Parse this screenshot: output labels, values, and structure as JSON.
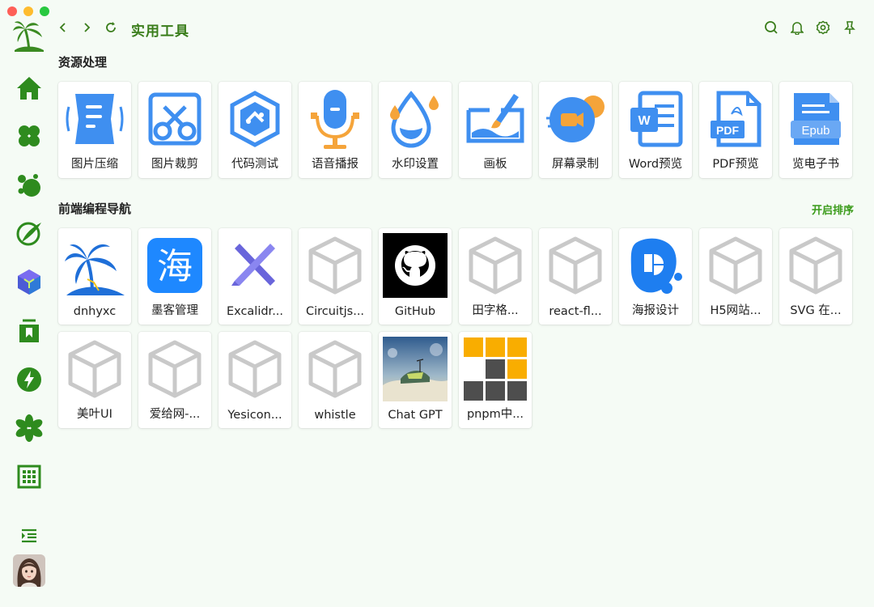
{
  "window": {
    "title": "实用工具"
  },
  "sidebar": {
    "items": [
      {
        "icon": "home-icon"
      },
      {
        "icon": "clover-icon"
      },
      {
        "icon": "bubbles-icon"
      },
      {
        "icon": "brush-icon"
      },
      {
        "icon": "cube-icon"
      },
      {
        "icon": "bookmark-icon"
      },
      {
        "icon": "lightning-icon"
      },
      {
        "icon": "asterisk-icon"
      },
      {
        "icon": "calendar-grid-icon"
      }
    ]
  },
  "header": {
    "title": "实用工具"
  },
  "sections": {
    "resources": {
      "title": "资源处理",
      "items": [
        {
          "label": "图片压缩",
          "icon": "image-compress-icon"
        },
        {
          "label": "图片裁剪",
          "icon": "scissors-icon"
        },
        {
          "label": "代码测试",
          "icon": "code-test-icon"
        },
        {
          "label": "语音播报",
          "icon": "microphone-icon"
        },
        {
          "label": "水印设置",
          "icon": "water-drop-icon"
        },
        {
          "label": "画板",
          "icon": "paint-board-icon"
        },
        {
          "label": "屏幕录制",
          "icon": "screen-record-icon"
        },
        {
          "label": "Word预览",
          "icon": "word-doc-icon"
        },
        {
          "label": "PDF预览",
          "icon": "pdf-doc-icon"
        },
        {
          "label": "览电子书",
          "icon": "epub-icon"
        }
      ]
    },
    "frontend": {
      "title": "前端编程导航",
      "sort_label": "开启排序",
      "items": [
        {
          "label": "dnhyxc",
          "icon": "palm-logo-icon"
        },
        {
          "label": "墨客管理",
          "icon": "hai-logo-icon"
        },
        {
          "label": "Excalidr...",
          "icon": "excalidraw-icon"
        },
        {
          "label": "Circuitjs...",
          "icon": "box-placeholder-icon"
        },
        {
          "label": "GitHub",
          "icon": "github-icon"
        },
        {
          "label": "田字格...",
          "icon": "box-placeholder-icon"
        },
        {
          "label": "react-fl...",
          "icon": "box-placeholder-icon"
        },
        {
          "label": "海报设计",
          "icon": "poster-design-icon"
        },
        {
          "label": "H5网站...",
          "icon": "box-placeholder-icon"
        },
        {
          "label": "SVG 在...",
          "icon": "box-placeholder-icon"
        },
        {
          "label": "美叶UI",
          "icon": "box-placeholder-icon"
        },
        {
          "label": "爱给网-...",
          "icon": "box-placeholder-icon"
        },
        {
          "label": "Yesicon...",
          "icon": "box-placeholder-icon"
        },
        {
          "label": "whistle",
          "icon": "box-placeholder-icon"
        },
        {
          "label": "Chat GPT",
          "icon": "landscape-image-icon"
        },
        {
          "label": "pnpm中...",
          "icon": "pnpm-icon"
        }
      ]
    }
  },
  "colors": {
    "accent": "#3a7d1b",
    "sidebar_icon": "#2e8b1e",
    "tool_blue": "#3f8ff0",
    "bg": "#f5fbf5"
  }
}
